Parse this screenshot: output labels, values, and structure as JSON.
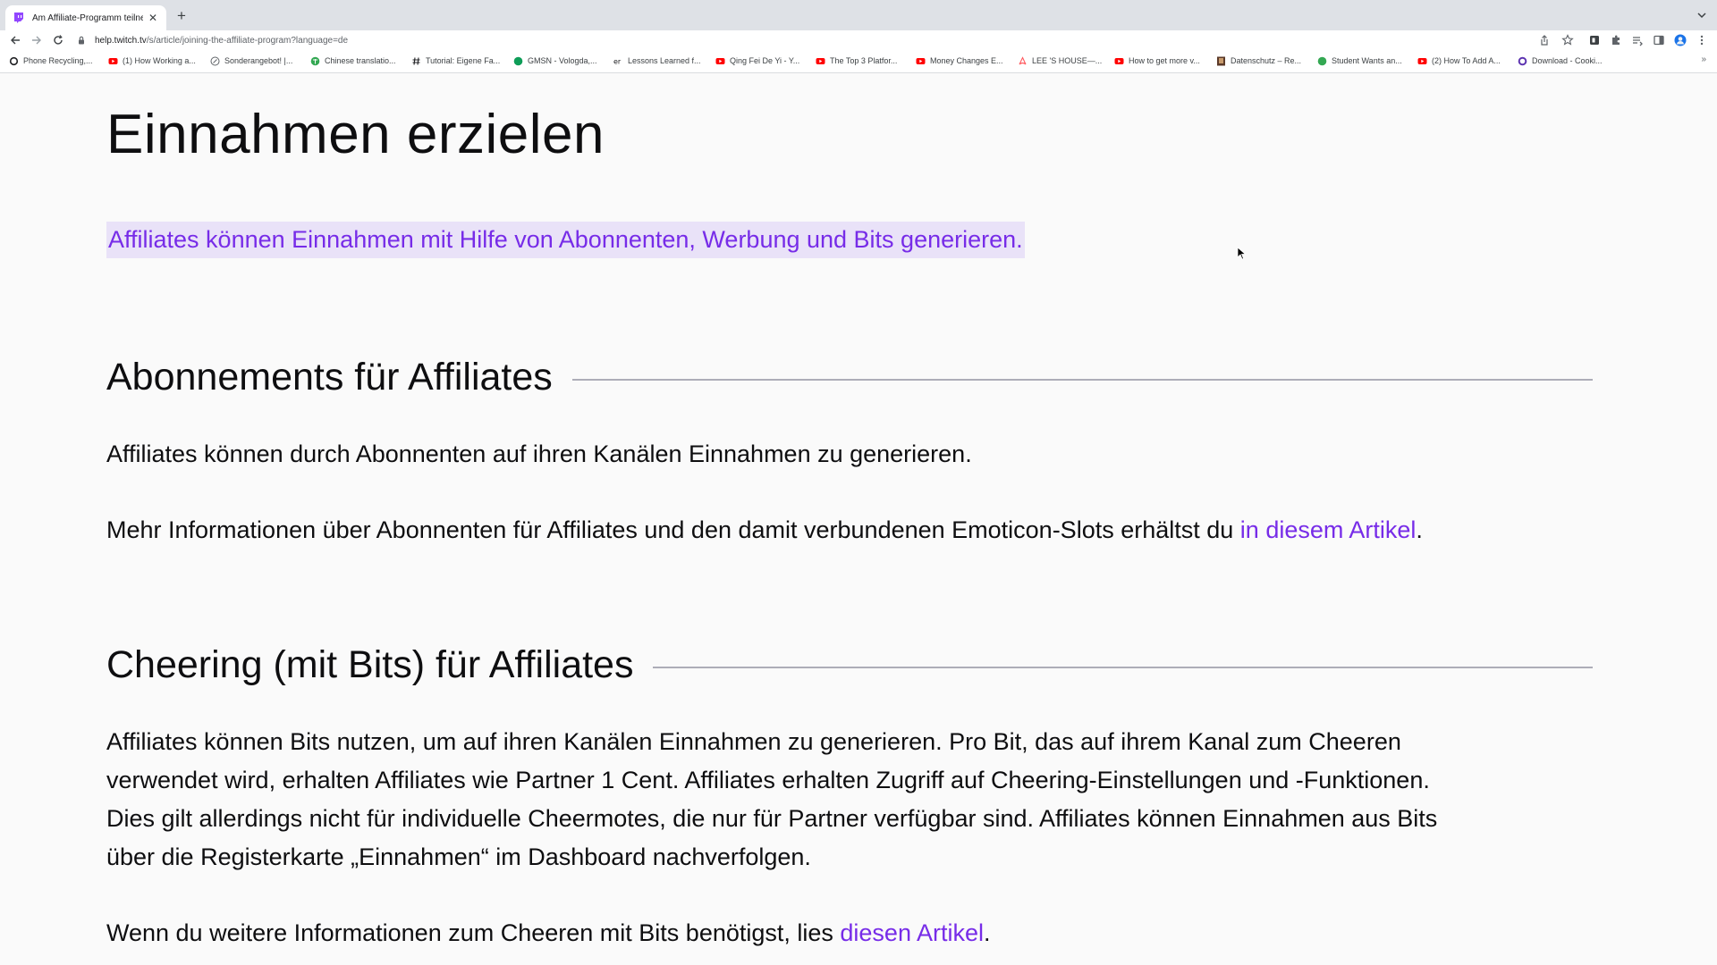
{
  "browser": {
    "tab_title": "Am Affiliate-Programm teilneh",
    "url_host": "help.twitch.tv",
    "url_path": "/s/article/joining-the-affiliate-program?language=de",
    "bookmarks": [
      {
        "label": "Phone Recycling,...",
        "icon": "o-icon",
        "color": "#202124"
      },
      {
        "label": "(1) How Working a...",
        "icon": "youtube-icon",
        "color": "#ff0000"
      },
      {
        "label": "Sonderangebot! |...",
        "icon": "tag-icon",
        "color": "#5f6368"
      },
      {
        "label": "Chinese translatio...",
        "icon": "globe-icon",
        "color": "#34a853"
      },
      {
        "label": "Tutorial: Eigene Fa...",
        "icon": "hash-icon",
        "color": "#202124"
      },
      {
        "label": "GMSN - Vologda,...",
        "icon": "circle-icon",
        "color": "#0f9d58"
      },
      {
        "label": "Lessons Learned f...",
        "icon": "letters-icon",
        "color": "#202124"
      },
      {
        "label": "Qing Fei De Yi - Y...",
        "icon": "youtube-icon",
        "color": "#ff0000"
      },
      {
        "label": "The Top 3 Platfor...",
        "icon": "youtube-icon",
        "color": "#ff0000"
      },
      {
        "label": "Money Changes E...",
        "icon": "youtube-icon",
        "color": "#ff0000"
      },
      {
        "label": "LEE 'S HOUSE—...",
        "icon": "airbnb-icon",
        "color": "#ff5a5f"
      },
      {
        "label": "How to get more v...",
        "icon": "youtube-icon",
        "color": "#ff0000"
      },
      {
        "label": "Datenschutz – Re...",
        "icon": "image-icon",
        "color": "#5b3a29"
      },
      {
        "label": "Student Wants an...",
        "icon": "circle-icon",
        "color": "#34a853"
      },
      {
        "label": "(2) How To Add A...",
        "icon": "youtube-icon",
        "color": "#ff0000"
      },
      {
        "label": "Download - Cooki...",
        "icon": "ring-icon",
        "color": "#5e35b1"
      }
    ],
    "bookmarks_more": "»"
  },
  "article": {
    "title": "Einnahmen erzielen",
    "lead": "Affiliates können Einnahmen mit Hilfe von Abonnenten, Werbung und Bits generieren.",
    "section1": {
      "heading": "Abonnements für Affiliates",
      "p1": "Affiliates können durch Abonnenten auf ihren Kanälen Einnahmen zu generieren.",
      "p2_text": "Mehr Informationen über Abonnenten für Affiliates und den damit verbundenen Emoticon-Slots erhältst du ",
      "p2_link": "in diesem Artikel",
      "p2_end": "."
    },
    "section2": {
      "heading": "Cheering (mit Bits) für Affiliates",
      "p1_line1": "Affiliates können Bits nutzen, um auf ihren Kanälen Einnahmen zu generieren. Pro Bit, das auf ihrem Kanal zum Cheeren",
      "p1_line2": "verwendet wird, erhalten Affiliates wie Partner 1 Cent. Affiliates erhalten Zugriff auf Cheering-Einstellungen und -Funktionen.",
      "p1_line3": "Dies gilt allerdings nicht für individuelle Cheermotes, die nur für Partner verfügbar sind. Affiliates können Einnahmen aus Bits",
      "p1_line4": "über die Registerkarte „Einnahmen“ im Dashboard nachverfolgen.",
      "p2_text": "Wenn du weitere Informationen zum Cheeren mit Bits benötigst, lies ",
      "p2_link": "diesen Artikel",
      "p2_end": "."
    }
  },
  "colors": {
    "accent": "#772ce8",
    "highlight": "#e9e2f8",
    "text": "#0e0e10"
  }
}
